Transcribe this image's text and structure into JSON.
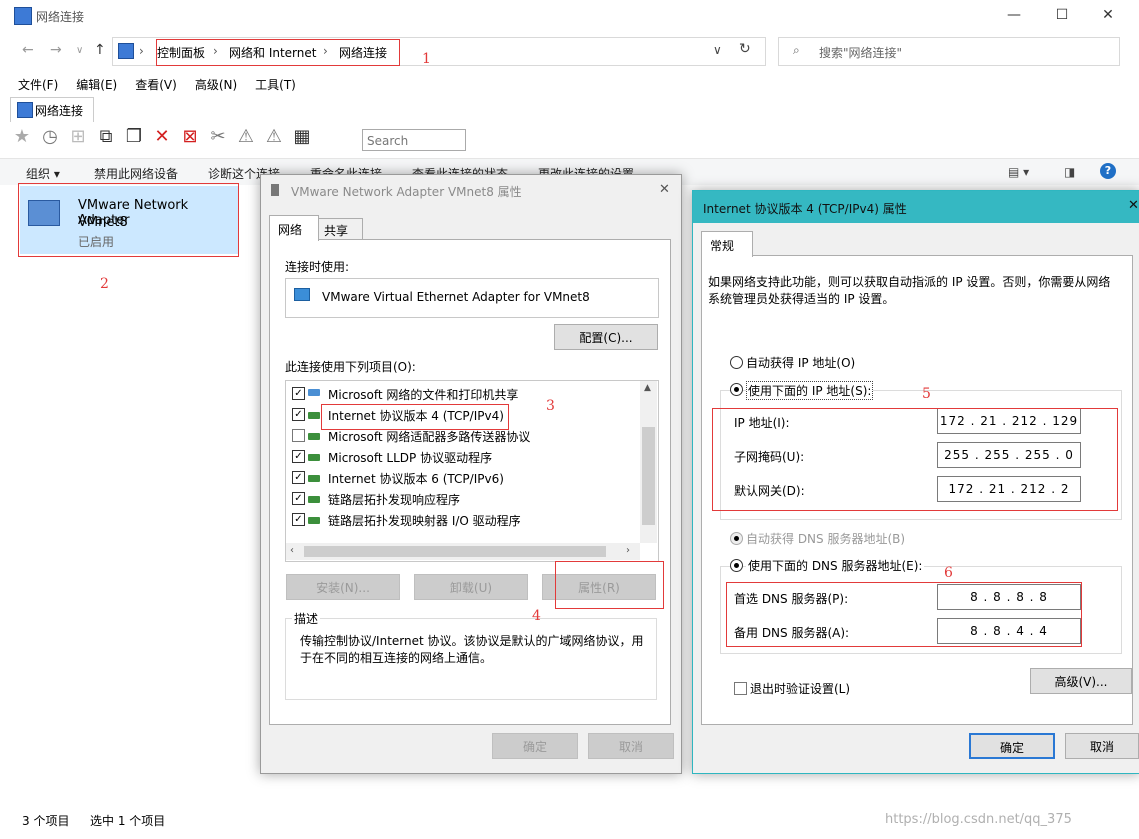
{
  "window": {
    "title": "网络连接"
  },
  "address": {
    "crumbs": [
      "控制面板",
      "网络和 Internet",
      "网络连接"
    ],
    "search_placeholder": "搜索\"网络连接\""
  },
  "menu": [
    "文件(F)",
    "编辑(E)",
    "查看(V)",
    "高级(N)",
    "工具(T)"
  ],
  "tab": {
    "label": "网络连接"
  },
  "toolbar": {
    "search_placeholder": "Search"
  },
  "commands": [
    "组织 ▾",
    "禁用此网络设备",
    "诊断这个连接",
    "重命名此连接",
    "查看此连接的状态",
    "更改此连接的设置"
  ],
  "adapter": {
    "name": "VMware Network Adapter",
    "sub": "VMnet8",
    "status": "已启用"
  },
  "status": {
    "count": "3 个项目",
    "selected": "选中 1 个项目",
    "watermark": "https://blog.csdn.net/qq_375"
  },
  "annotations": [
    "1",
    "2",
    "3",
    "4",
    "5",
    "6"
  ],
  "dialog1": {
    "title": "VMware Network Adapter VMnet8 属性",
    "tabs": [
      "网络",
      "共享"
    ],
    "connect_using_label": "连接时使用:",
    "adapter_name": "VMware Virtual Ethernet Adapter for VMnet8",
    "configure": "配置(C)...",
    "items_label": "此连接使用下列项目(O):",
    "items": [
      {
        "label": "Microsoft 网络的文件和打印机共享",
        "checked": true
      },
      {
        "label": "Internet 协议版本 4 (TCP/IPv4)",
        "checked": true
      },
      {
        "label": "Microsoft 网络适配器多路传送器协议",
        "checked": false
      },
      {
        "label": "Microsoft LLDP 协议驱动程序",
        "checked": true
      },
      {
        "label": "Internet 协议版本 6 (TCP/IPv6)",
        "checked": true
      },
      {
        "label": "链路层拓扑发现响应程序",
        "checked": true
      },
      {
        "label": "链路层拓扑发现映射器 I/O 驱动程序",
        "checked": true
      }
    ],
    "install": "安装(N)...",
    "uninstall": "卸载(U)",
    "properties": "属性(R)",
    "desc_title": "描述",
    "desc_text": "传输控制协议/Internet 协议。该协议是默认的广域网络协议，用于在不同的相互连接的网络上通信。",
    "ok": "确定",
    "cancel": "取消"
  },
  "dialog2": {
    "title": "Internet 协议版本 4 (TCP/IPv4) 属性",
    "tab": "常规",
    "intro": "如果网络支持此功能，则可以获取自动指派的 IP 设置。否则，你需要从网络系统管理员处获得适当的 IP 设置。",
    "auto_ip": "自动获得 IP 地址(O)",
    "manual_ip": "使用下面的 IP 地址(S):",
    "ip_label": "IP 地址(I):",
    "ip": "172 . 21 . 212 . 129",
    "mask_label": "子网掩码(U):",
    "mask": "255 . 255 . 255 . 0",
    "gw_label": "默认网关(D):",
    "gw": "172 . 21 . 212 . 2",
    "auto_dns": "自动获得 DNS 服务器地址(B)",
    "manual_dns": "使用下面的 DNS 服务器地址(E):",
    "dns1_label": "首选 DNS 服务器(P):",
    "dns1": "8 . 8 . 8 . 8",
    "dns2_label": "备用 DNS 服务器(A):",
    "dns2": "8 . 8 . 4 . 4",
    "validate": "退出时验证设置(L)",
    "advanced": "高级(V)...",
    "ok": "确定",
    "cancel": "取消"
  }
}
